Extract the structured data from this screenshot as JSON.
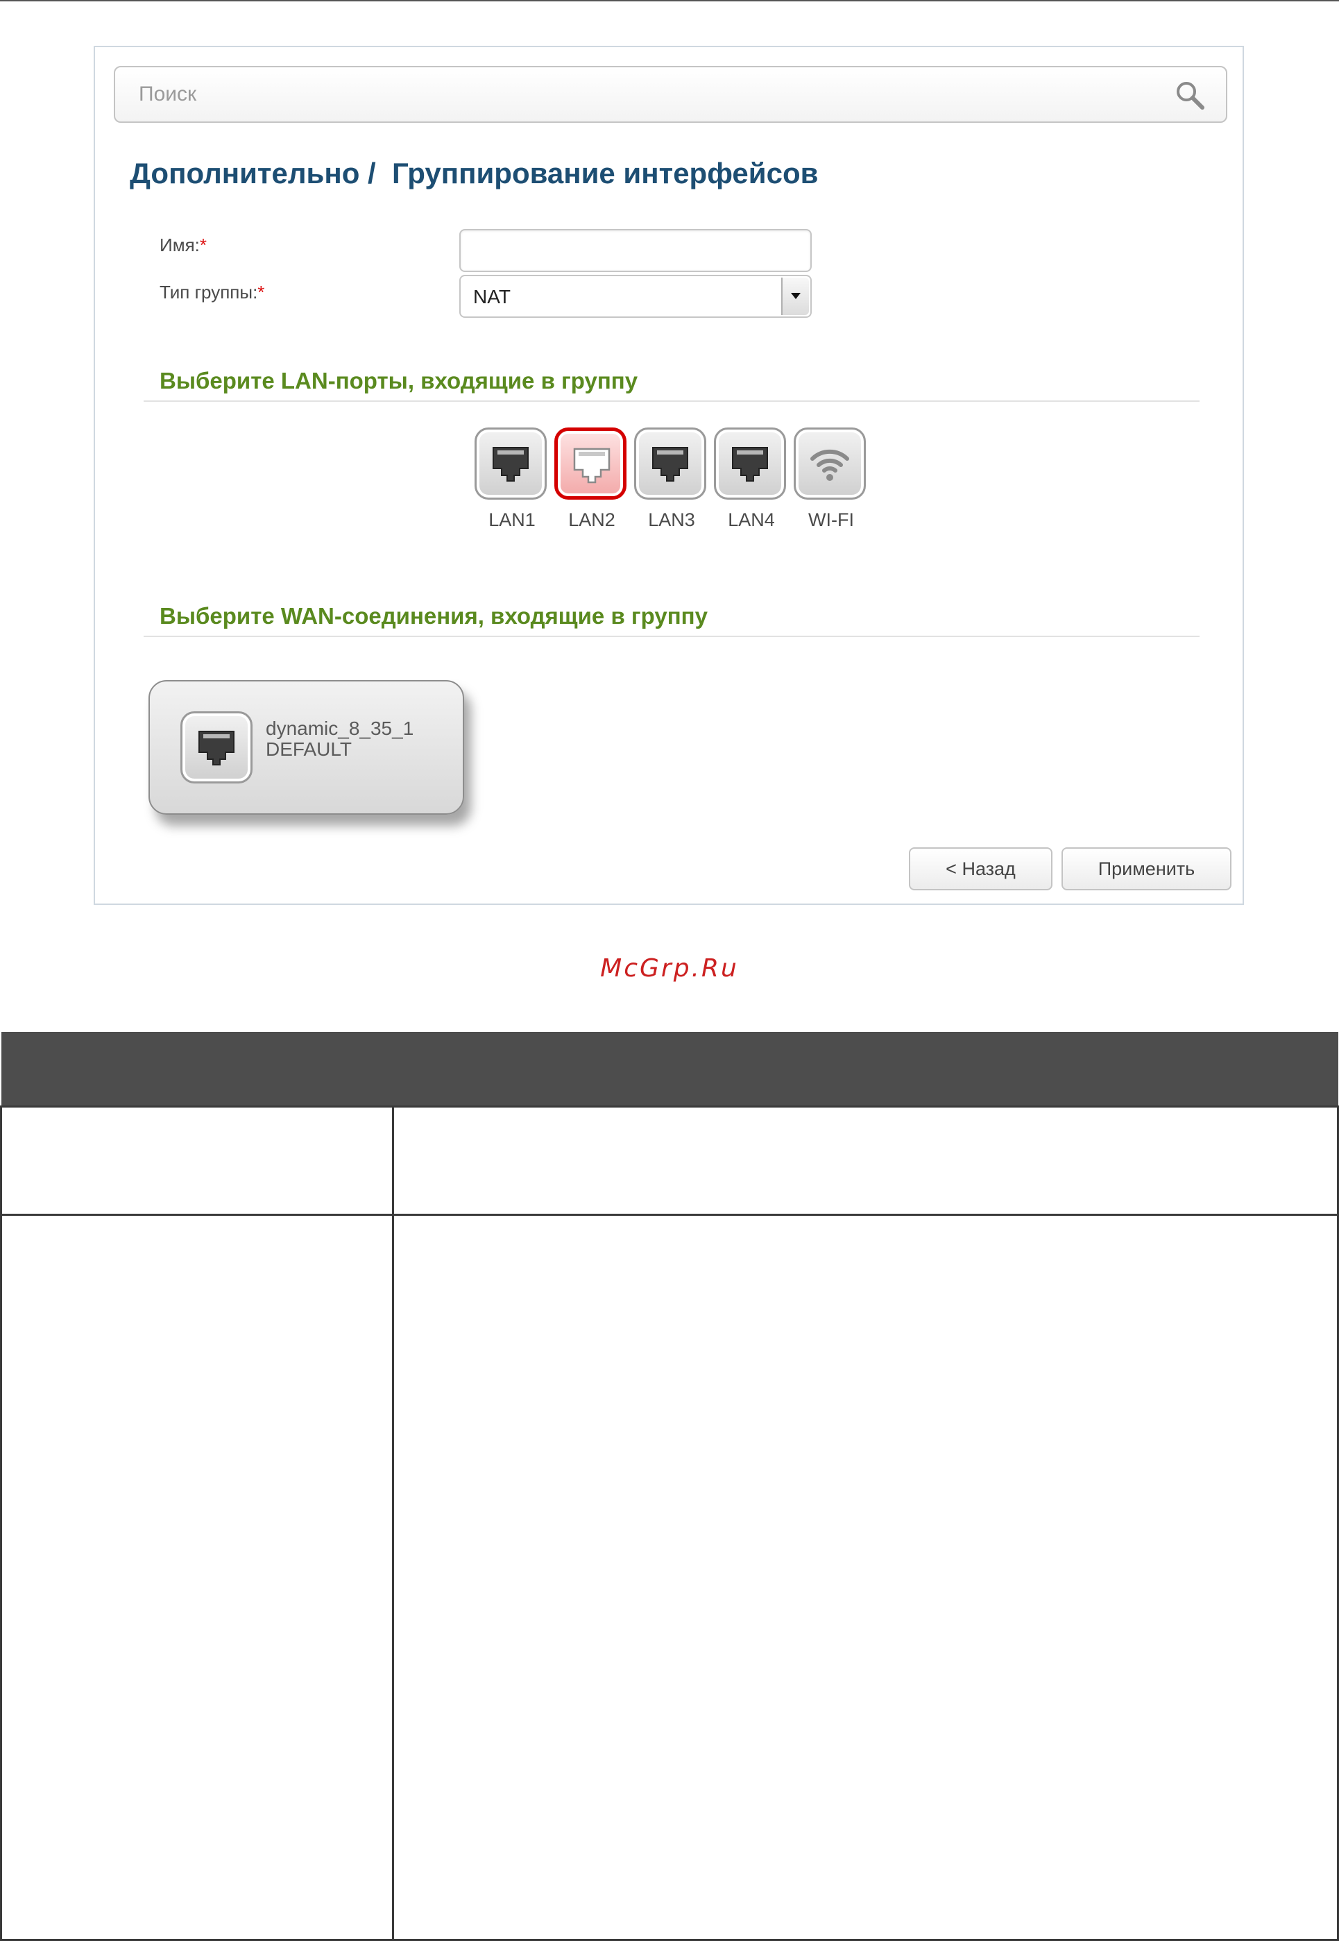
{
  "search": {
    "placeholder": "Поиск"
  },
  "page": {
    "title": "Дополнительно /  Группирование интерфейсов"
  },
  "form": {
    "name_label": "Имя:",
    "name_value": "",
    "group_type_label": "Тип группы:",
    "required_mark": "*",
    "group_type_value": "NAT"
  },
  "lan_section": {
    "heading": "Выберите LAN-порты, входящие в группу",
    "ports": [
      {
        "label": "LAN1",
        "icon": "ethernet-port-icon",
        "selected": false
      },
      {
        "label": "LAN2",
        "icon": "ethernet-port-icon",
        "selected": true
      },
      {
        "label": "LAN3",
        "icon": "ethernet-port-icon",
        "selected": false
      },
      {
        "label": "LAN4",
        "icon": "ethernet-port-icon",
        "selected": false
      },
      {
        "label": "WI-FI",
        "icon": "wifi-icon",
        "selected": false
      }
    ]
  },
  "wan_section": {
    "heading": "Выберите WAN-соединения, входящие в группу",
    "connection": {
      "name": "dynamic_8_35_1",
      "subtitle": "DEFAULT",
      "icon": "ethernet-port-icon"
    }
  },
  "buttons": {
    "back": "< Назад",
    "apply": "Применить"
  },
  "watermark": "McGrp.Ru",
  "colors": {
    "title": "#1d4e73",
    "section_heading": "#5a8a1f",
    "selected_port": "#d40000",
    "watermark": "#cc2020",
    "table_header": "#4d4d4d"
  }
}
